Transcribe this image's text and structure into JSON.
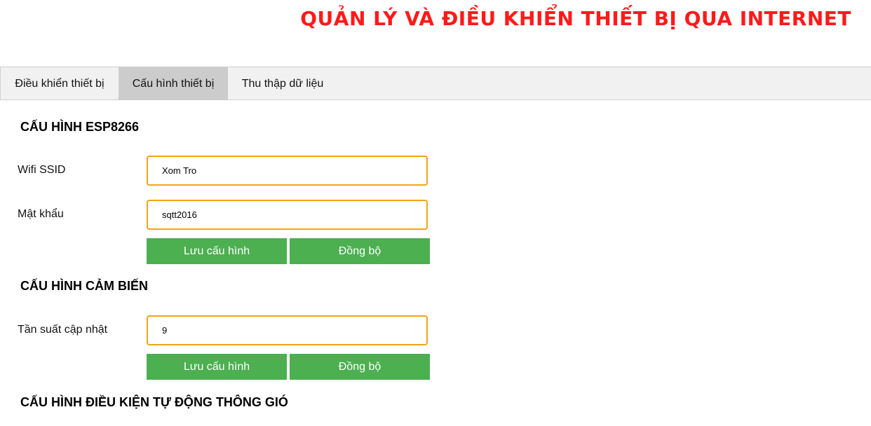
{
  "page": {
    "title": "QUẢN LÝ VÀ ĐIỀU KHIỂN THIẾT BỊ QUA INTERNET"
  },
  "tabs": [
    {
      "label": "Điều khiển thiết bị",
      "active": false
    },
    {
      "label": "Cấu hình thiết bị",
      "active": true
    },
    {
      "label": "Thu thập dữ liệu",
      "active": false
    }
  ],
  "esp_config": {
    "heading": "CẤU HÌNH ESP8266",
    "ssid_label": "Wifi SSID",
    "ssid_value": "Xom Tro",
    "password_label": "Mật khẩu",
    "password_value": "sqtt2016",
    "save_label": "Lưu cấu hình",
    "sync_label": "Đồng bộ"
  },
  "sensor_config": {
    "heading": "CẤU HÌNH CẢM BIẾN",
    "frequency_label": "Tần suất cập nhật",
    "frequency_value": "9",
    "save_label": "Lưu cấu hình",
    "sync_label": "Đồng bộ"
  },
  "ventilation_config": {
    "heading": "CẤU HÌNH ĐIỀU KIỆN TỰ ĐỘNG THÔNG GIÓ"
  },
  "colors": {
    "title": "#ff1a1a",
    "button": "#4caf50",
    "input_border": "#f0a515",
    "active_tab": "#cccccc",
    "tabbar": "#f1f1f1"
  }
}
